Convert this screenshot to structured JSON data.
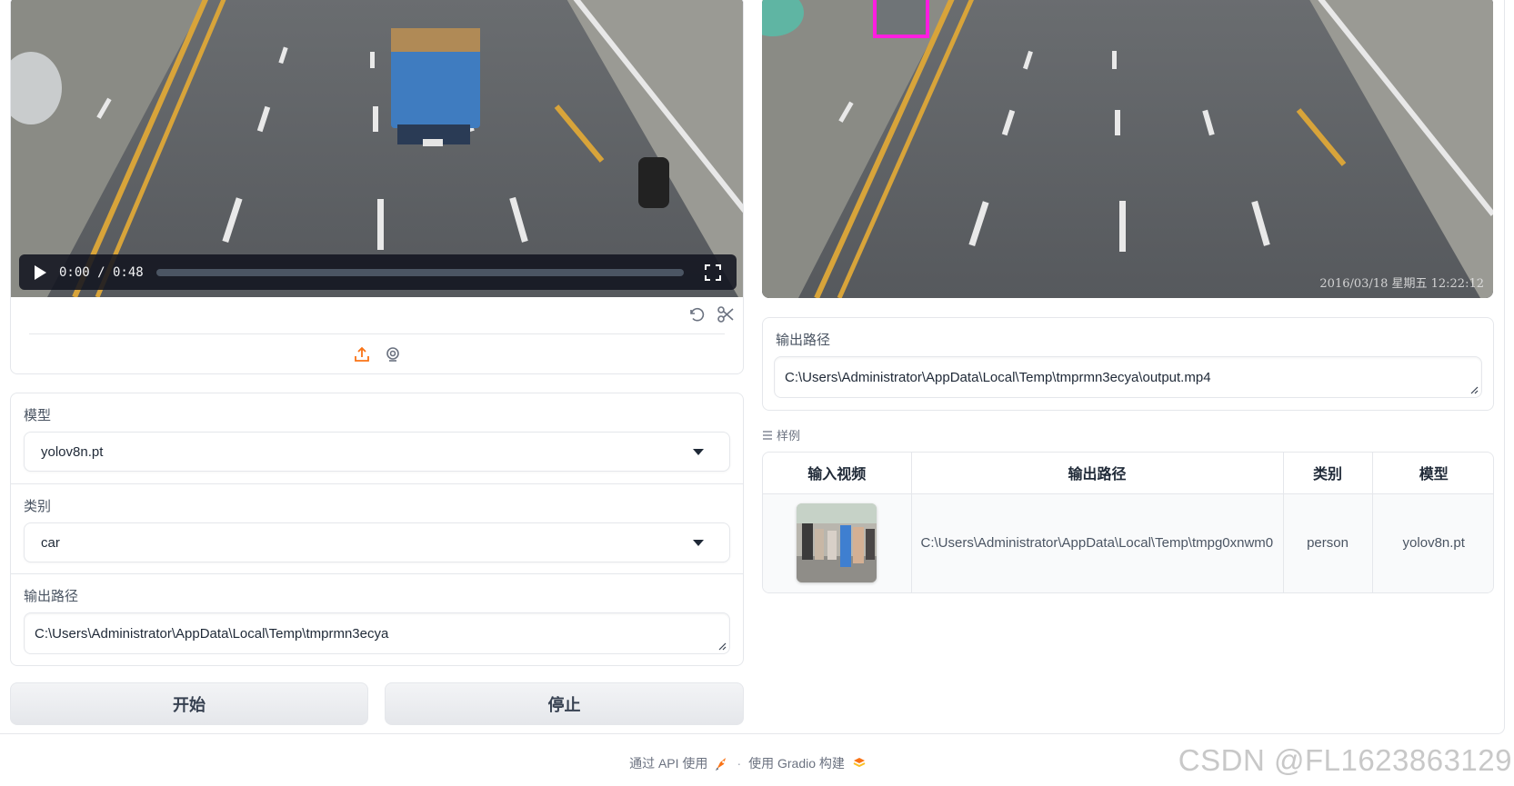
{
  "input_video": {
    "time_display": "0:00 / 0:48",
    "play_icon": "play-icon",
    "fullscreen_icon": "fullscreen-icon",
    "undo_icon": "undo-icon",
    "trim_icon": "scissors-icon",
    "upload_icon": "upload-icon",
    "webcam_icon": "webcam-icon",
    "progress": 0
  },
  "form": {
    "model_label": "模型",
    "model_value": "yolov8n.pt",
    "category_label": "类别",
    "category_value": "car",
    "output_label": "输出路径",
    "output_value": "C:\\Users\\Administrator\\AppData\\Local\\Temp\\tmprmn3ecya"
  },
  "buttons": {
    "start_label": "开始",
    "stop_label": "停止"
  },
  "output_video": {
    "timestamp": "2016/03/18 星期五 12:22:12"
  },
  "output_path": {
    "label": "输出路径",
    "value": "C:\\Users\\Administrator\\AppData\\Local\\Temp\\tmprmn3ecya\\output.mp4"
  },
  "examples": {
    "label": "样例",
    "headers": [
      "输入视频",
      "输出路径",
      "类别",
      "模型"
    ],
    "rows": [
      {
        "output_path": "C:\\Users\\Administrator\\AppData\\Local\\Temp\\tmpg0xnwm0",
        "category": "person",
        "model": "yolov8n.pt"
      }
    ]
  },
  "footer": {
    "api_text": "通过 API 使用",
    "separator": "·",
    "built_text": "使用 Gradio 构建",
    "rocket_icon": "rocket-icon",
    "gradio_logo_icon": "gradio-logo-icon"
  },
  "watermark": "CSDN @FL1623863129",
  "colors": {
    "accent": "#f97316",
    "detection_box": "#ff1de0"
  }
}
